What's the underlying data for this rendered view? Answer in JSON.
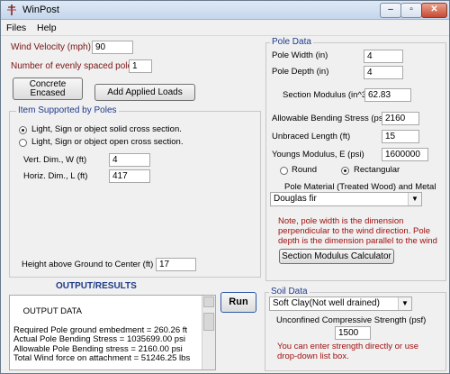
{
  "window": {
    "title": "WinPost"
  },
  "menubar": {
    "files": "Files",
    "help": "Help"
  },
  "wind": {
    "wind_velocity_label": "Wind Velocity (mph)",
    "wind_velocity_value": "90",
    "poles_label": "Number of evenly spaced poles",
    "poles_value": "1"
  },
  "buttons": {
    "concrete_line1": "Concrete",
    "concrete_line2": "Encased",
    "add_loads": "Add Applied Loads",
    "run": "Run",
    "section_calc": "Section Modulus Calculator"
  },
  "item_group": {
    "title": "Item Supported by Poles",
    "option_solid": "Light, Sign or object solid cross section.",
    "option_open": "Light, Sign or object open cross section.",
    "selected": "solid",
    "vert_label": "Vert. Dim., W (ft)",
    "vert_value": "4",
    "horiz_label": "Horiz. Dim., L (ft)",
    "horiz_value": "417",
    "height_label": "Height above Ground to Center (ft)",
    "height_value": "17"
  },
  "output": {
    "heading": "OUTPUT/RESULTS",
    "text": "OUTPUT DATA\n\nRequired Pole ground embedment = 260.26 ft\nActual Pole Bending Stress = 1035699.00 psi\nAllowable Pole Bending stress = 2160.00 psi\nTotal Wind force on attachment = 51246.25 lbs"
  },
  "pole_data": {
    "title": "Pole Data",
    "width_label": "Pole Width (in)",
    "width_value": "4",
    "depth_label": "Pole Depth (in)",
    "depth_value": "4",
    "modulus_label": "Section Modulus (in^3)",
    "modulus_value": "62.83",
    "bending_label": "Allowable Bending Stress (psi)",
    "bending_value": "2160",
    "unbraced_label": "Unbraced Length (ft)",
    "unbraced_value": "15",
    "youngs_label": "Youngs Modulus, E (psi)",
    "youngs_value": "1600000",
    "shape_round": "Round",
    "shape_rect": "Rectangular",
    "shape_selected": "Rectangular",
    "material_label": "Pole Material (Treated Wood) and Metal",
    "material_value": "Douglas fir",
    "note": "Note, pole width is the dimension perpendicular to the wind direction. Pole depth is the dimension parallel to the wind"
  },
  "soil_data": {
    "title": "Soil Data",
    "soil_value": "Soft Clay(Not well drained)",
    "strength_label": "Unconfined Compressive Strength (psf)",
    "strength_value": "1500",
    "note": "You can enter strength directly or use drop-down list box."
  },
  "colors": {
    "label_red": "#7a1313",
    "label_blue": "#1e3a8a",
    "note_red": "#a01010"
  }
}
